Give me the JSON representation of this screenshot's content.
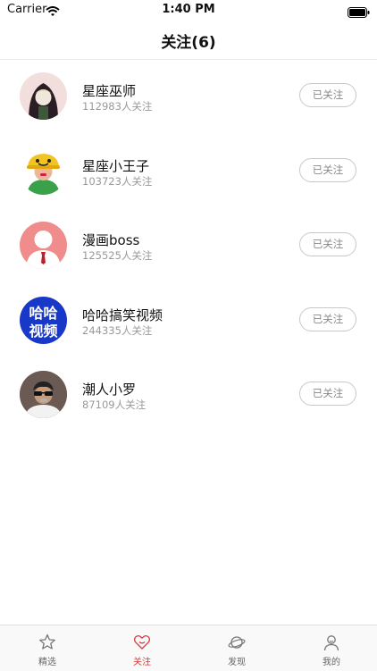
{
  "status_bar": {
    "carrier": "Carrier",
    "time": "1:40 PM"
  },
  "header": {
    "title": "关注(6)"
  },
  "follow_list": [
    {
      "name": "星座巫师",
      "followers": "112983人关注",
      "button": "已关注"
    },
    {
      "name": "星座小王子",
      "followers": "103723人关注",
      "button": "已关注"
    },
    {
      "name": "漫画boss",
      "followers": "125525人关注",
      "button": "已关注"
    },
    {
      "name": "哈哈搞笑视频",
      "followers": "244335人关注",
      "button": "已关注",
      "avatar_text": [
        "哈哈",
        "视频"
      ]
    },
    {
      "name": "潮人小罗",
      "followers": "87109人关注",
      "button": "已关注"
    }
  ],
  "tabs": [
    {
      "label": "精选",
      "icon": "star-icon",
      "active": false
    },
    {
      "label": "关注",
      "icon": "heart-icon",
      "active": true
    },
    {
      "label": "发现",
      "icon": "planet-icon",
      "active": false
    },
    {
      "label": "我的",
      "icon": "user-icon",
      "active": false
    }
  ],
  "colors": {
    "accent": "#d83a3a",
    "text_secondary": "#999999",
    "button_border": "#c8c8c8"
  }
}
